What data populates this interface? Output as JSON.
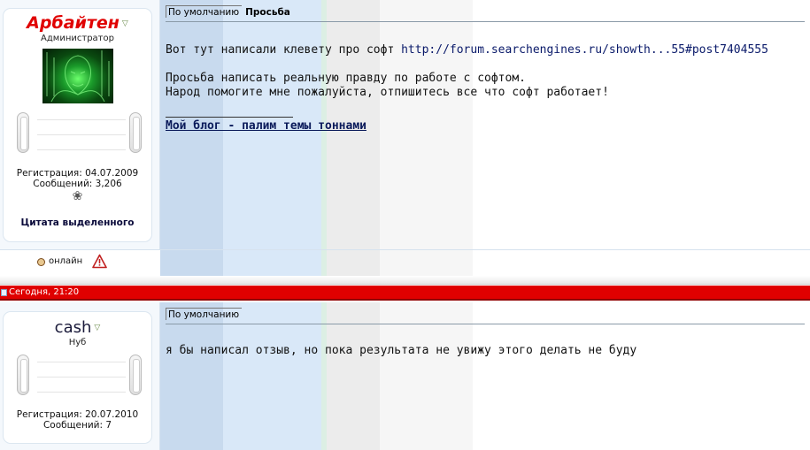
{
  "posts": [
    {
      "username": "Арбайтен",
      "user_title": "Администратор",
      "registration": "Регистрация: 04.07.2009",
      "messages": "Сообщений: 3,206",
      "quote_selected": "Цитата выделенного",
      "header_tag": "По умолчанию",
      "title": "Просьба",
      "line1_prefix": "Вот тут написали клевету про софт ",
      "line1_link": "http://forum.searchengines.ru/showth...55#post7404555",
      "line2": "Просьба написать реальную правду по работе с софтом.",
      "line3": "Народ помогите мне пожалуйста, отпишитесь все что софт работает!",
      "signature": "Мой блог - палим темы тоннами",
      "online_status": "онлайн"
    },
    {
      "date_text": "Сегодня, 21:20",
      "username": "cash",
      "user_title": "Нуб",
      "registration": "Регистрация: 20.07.2010",
      "messages": "Сообщений: 7",
      "header_tag": "По умолчанию",
      "text": "я бы написал отзыв, но пока результата не увижу этого делать не буду"
    }
  ],
  "icons": {
    "user_menu": "triangle-down-icon",
    "badge": "flower-icon",
    "online": "status-dot-icon",
    "report": "warning-triangle-icon",
    "date": "post-date-icon"
  },
  "colors": {
    "date_bar": "#e00000",
    "admin_name": "#e00000",
    "link": "#0a1a6a"
  }
}
